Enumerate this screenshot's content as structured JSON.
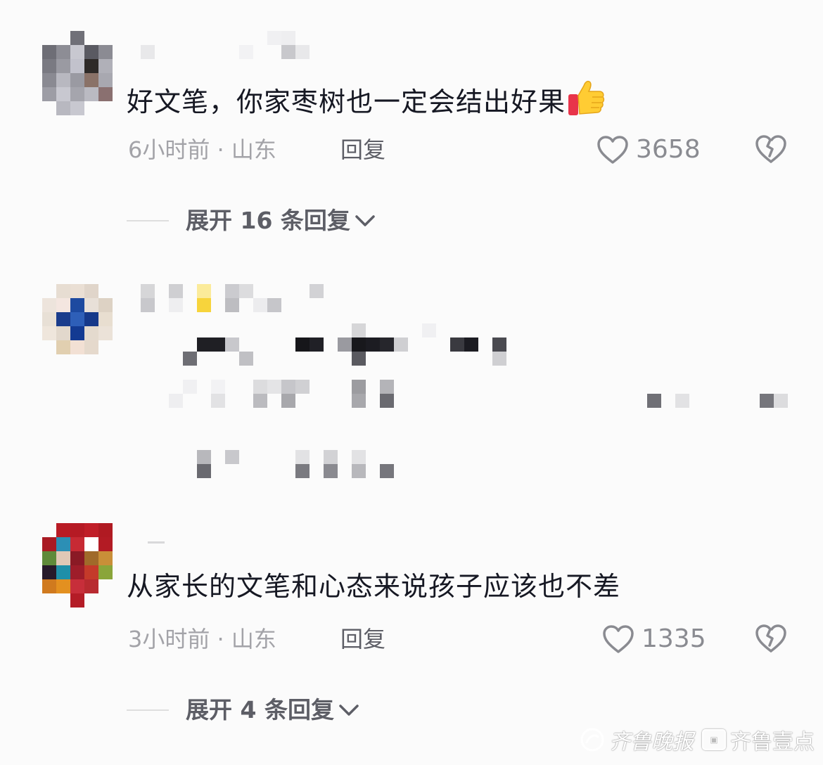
{
  "comments": [
    {
      "text": "好文笔，你家枣树也一定会结出好果",
      "emoji": "thumbs-up",
      "meta": "6小时前 · 山东",
      "reply_label": "回复",
      "likes": "3658",
      "expand_label": "展开 16 条回复"
    },
    {
      "text": "",
      "meta": "",
      "likes": ""
    },
    {
      "text": "从家长的文笔和心态来说孩子应该也不差",
      "meta": "3小时前 · 山东",
      "reply_label": "回复",
      "likes": "1335",
      "expand_label": "展开 4 条回复"
    }
  ],
  "watermark": {
    "brand_script": "齐鲁晚报",
    "brand_text": "齐鲁壹点"
  },
  "icons": {
    "like": "heart-outline-icon",
    "dislike": "broken-heart-icon",
    "expand": "chevron-down-icon",
    "emoji": "thumbs-up-icon"
  }
}
